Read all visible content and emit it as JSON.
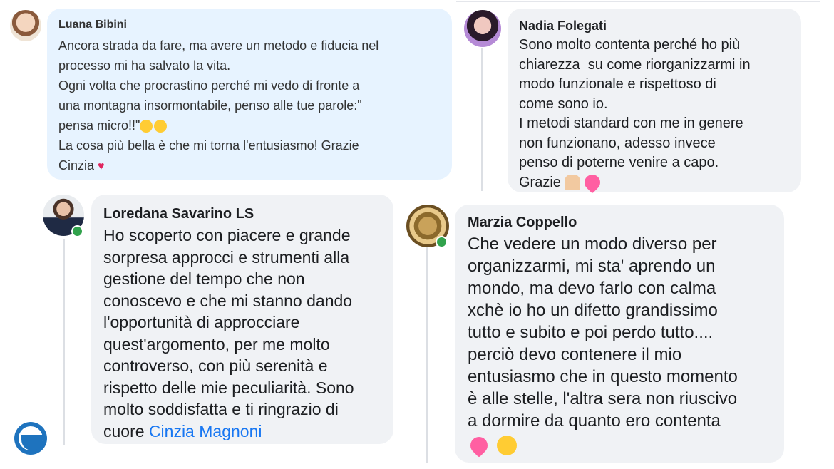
{
  "comments": [
    {
      "author": "Luana Bibini",
      "lines": [
        "Ancora strada da fare, ma avere un metodo e fiducia nel",
        "processo mi ha salvato la vita.",
        "Ogni volta che procrastino perché mi vedo di fronte a",
        "una montagna insormontabile, penso alle tue parole:\"",
        "pensa micro!!\"",
        "La cosa più bella è che mi torna l'entusiasmo! Grazie",
        "Cinzia"
      ],
      "emojis": [
        "laughing-tears-emoji",
        "heart-eyes-emoji",
        "red-heart-emoji"
      ]
    },
    {
      "author": "Nadia Folegati",
      "lines": [
        "Sono molto contenta perché ho più",
        "chiarezza  su come riorganizzarmi in",
        "modo funzionale e rispettoso di",
        "come sono io.",
        "I metodi standard con me in genere",
        "non funzionano, adesso invece",
        "penso di poterne venire a capo.",
        "Grazie"
      ],
      "emojis": [
        "folded-hands-emoji",
        "sparkling-heart-emoji"
      ]
    },
    {
      "author": "Loredana Savarino LS",
      "lines": [
        "Ho scoperto con piacere e grande",
        "sorpresa approcci e strumenti alla",
        "gestione del tempo che non",
        "conoscevo e che mi stanno dando",
        "l'opportunità di approcciare",
        "quest'argomento, per me molto",
        "controverso, con più serenità e",
        "rispetto delle mie peculiarità. Sono",
        "molto soddisfatta e ti ringrazio di",
        "cuore"
      ],
      "mention": "Cinzia Magnoni",
      "online": true
    },
    {
      "author": "Marzia Coppello",
      "lines": [
        "Che vedere un modo diverso per",
        "organizzarmi, mi sta' aprendo un",
        "mondo, ma devo farlo con calma",
        "xchè io ho un difetto grandissimo",
        "tutto e subito e poi perdo tutto....",
        "perciò devo contenere il mio",
        "entusiasmo che in questo momento",
        "è alle stelle, l'altra sera non riuscivo",
        "a dormire da quanto ero contenta"
      ],
      "emojis": [
        "sparkling-heart-emoji",
        "star-struck-emoji"
      ],
      "online": true
    }
  ],
  "colors": {
    "bubble_light_blue": "#e7f3ff",
    "bubble_gray": "#f0f2f5",
    "mention_blue": "#1877f2",
    "online_green": "#31a24c"
  }
}
